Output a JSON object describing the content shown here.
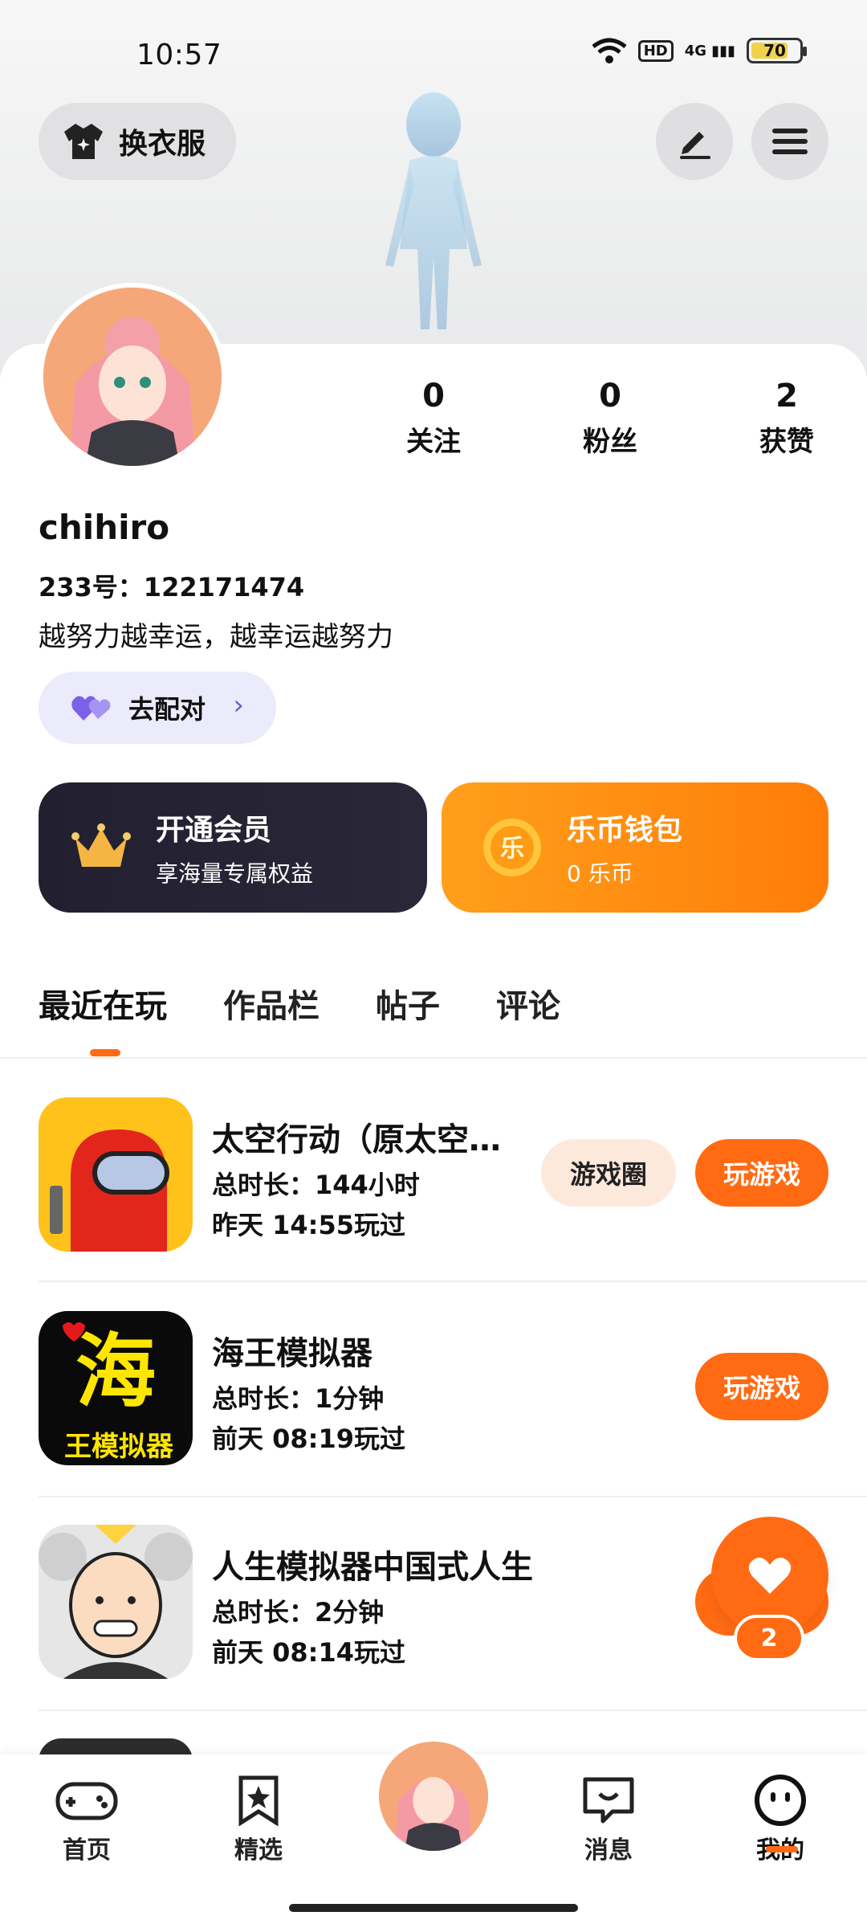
{
  "status_bar": {
    "time": "10:57",
    "battery": "70",
    "network": "4G",
    "hd": "HD"
  },
  "top": {
    "outfit_label": "换衣服"
  },
  "profile": {
    "username": "chihiro",
    "uid_label": "233号：122171474",
    "bio": "越努力越幸运，越幸运越努力",
    "match_label": "去配对",
    "stats": [
      {
        "num": "0",
        "label": "关注"
      },
      {
        "num": "0",
        "label": "粉丝"
      },
      {
        "num": "2",
        "label": "获赞"
      }
    ]
  },
  "promo": {
    "vip_title": "开通会员",
    "vip_sub": "享海量专属权益",
    "wallet_title": "乐币钱包",
    "wallet_sub": "0  乐币"
  },
  "tabs": [
    "最近在玩",
    "作品栏",
    "帖子",
    "评论"
  ],
  "games": [
    {
      "title": "太空行动（原太空…",
      "duration": "总时长：144小时",
      "last": "昨天  14:55玩过",
      "circle": "游戏圈",
      "play": "玩游戏"
    },
    {
      "title": "海王模拟器",
      "duration": "总时长：1分钟",
      "last": "前天  08:19玩过",
      "play": "玩游戏"
    },
    {
      "title": "人生模拟器中国式人生",
      "duration": "总时长：2分钟",
      "last": "前天  08:14玩过",
      "play": "玩游戏"
    }
  ],
  "like_fab": {
    "count": "2"
  },
  "bottom_nav": [
    {
      "label": "首页"
    },
    {
      "label": "精选"
    },
    {
      "label": "消息"
    },
    {
      "label": "我的"
    }
  ],
  "colors": {
    "accent": "#ff6a13",
    "vip_bg": "#222030",
    "wallet_bg": "#ff8c10",
    "match_bg": "#ecebfb"
  }
}
